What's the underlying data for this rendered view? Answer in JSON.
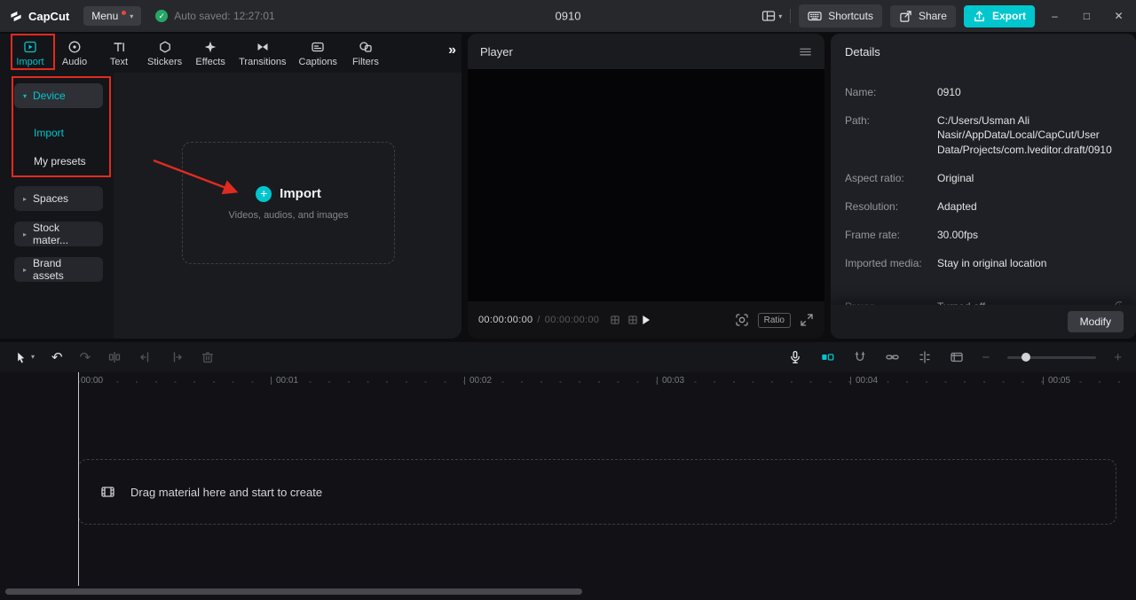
{
  "colors": {
    "accent": "#00c6cd",
    "annotation": "#e02b20",
    "autosave_green": "#27a667"
  },
  "titlebar": {
    "logo_text": "CapCut",
    "menu_label": "Menu",
    "autosave_text": "Auto saved: 12:27:01",
    "project_title": "0910",
    "shortcuts_label": "Shortcuts",
    "share_label": "Share",
    "export_label": "Export",
    "minimize_glyph": "–",
    "maximize_glyph": "□",
    "close_glyph": "✕"
  },
  "media_panel": {
    "tabs": [
      {
        "label": "Import"
      },
      {
        "label": "Audio"
      },
      {
        "label": "Text"
      },
      {
        "label": "Stickers"
      },
      {
        "label": "Effects"
      },
      {
        "label": "Transitions"
      },
      {
        "label": "Captions"
      },
      {
        "label": "Filters"
      }
    ],
    "more_glyph": "»",
    "sidebar": {
      "device": {
        "label": "Device"
      },
      "device_children": [
        {
          "label": "Import"
        },
        {
          "label": "My presets"
        }
      ],
      "collapsed": [
        {
          "label": "Spaces"
        },
        {
          "label": "Stock mater..."
        },
        {
          "label": "Brand assets"
        }
      ]
    },
    "import_box": {
      "plus": "+",
      "title": "Import",
      "subtitle": "Videos, audios, and images"
    }
  },
  "player": {
    "title": "Player",
    "timecode_current": "00:00:00:00",
    "timecode_separator": "/",
    "timecode_total": "00:00:00:00",
    "ratio_label": "Ratio"
  },
  "details": {
    "title": "Details",
    "rows": [
      {
        "label": "Name:",
        "value": "0910"
      },
      {
        "label": "Path:",
        "value": "C:/Users/Usman Ali Nasir/AppData/Local/CapCut/User Data/Projects/com.lveditor.draft/0910"
      },
      {
        "label": "Aspect ratio:",
        "value": "Original"
      },
      {
        "label": "Resolution:",
        "value": "Adapted"
      },
      {
        "label": "Frame rate:",
        "value": "30.00fps"
      },
      {
        "label": "Imported media:",
        "value": "Stay in original location"
      },
      {
        "label": "Proxy:",
        "value": "Turned off"
      }
    ],
    "modify_label": "Modify"
  },
  "timeline": {
    "ruler_labels": [
      "00:00",
      "00:01",
      "00:02",
      "00:03",
      "00:04",
      "00:05"
    ],
    "drag_hint": "Drag material here and start to create"
  }
}
